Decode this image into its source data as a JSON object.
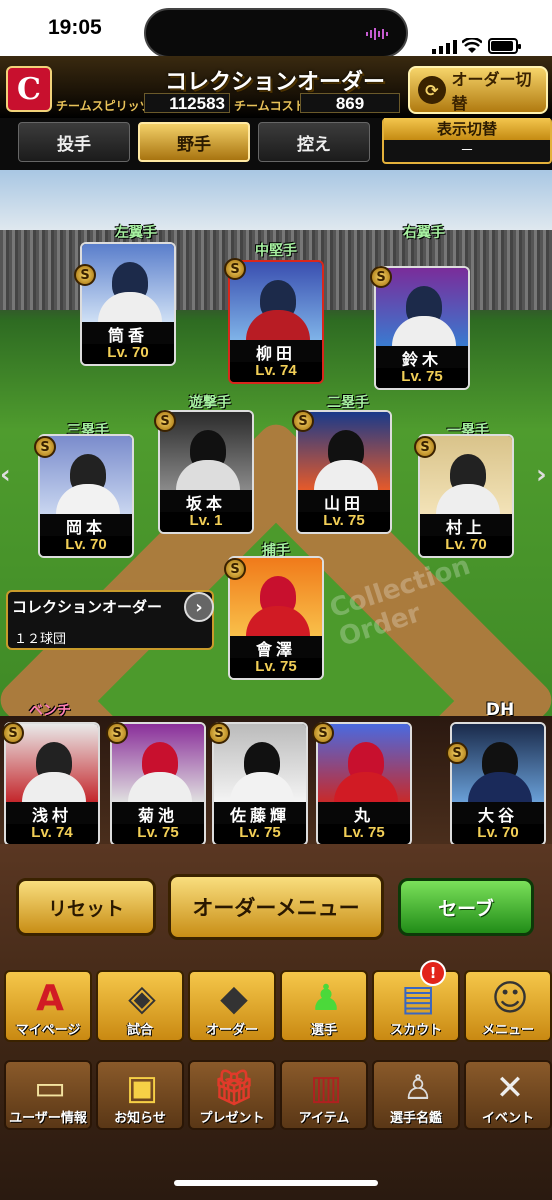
{
  "status": {
    "time": "19:05"
  },
  "header": {
    "team_logo": "C",
    "title": "コレクションオーダー",
    "spirits_label": "チームスピリッツ",
    "spirits_value": "112583",
    "cost_label": "チームコスト",
    "cost_value": "869",
    "order_switch_label": "オーダー切替"
  },
  "tabs": [
    {
      "label": "投手",
      "active": false
    },
    {
      "label": "野手",
      "active": true
    },
    {
      "label": "控え",
      "active": false
    }
  ],
  "view_toggle": {
    "label": "表示切替",
    "value": "－"
  },
  "positions": {
    "lf": "左翼手",
    "cf": "中堅手",
    "rf": "右翼手",
    "ss": "遊撃手",
    "b3": "三塁手",
    "b2": "二塁手",
    "b1": "一塁手",
    "c": "捕手",
    "bench": "ベンチ",
    "dh": "DH"
  },
  "lineup": {
    "lf": {
      "name": "筒香",
      "level": "Lv. 70"
    },
    "cf": {
      "name": "柳田",
      "level": "Lv. 74"
    },
    "rf": {
      "name": "鈴木",
      "level": "Lv. 75"
    },
    "ss": {
      "name": "坂本",
      "level": "Lv.  1"
    },
    "b3": {
      "name": "岡本",
      "level": "Lv. 70"
    },
    "b2": {
      "name": "山田",
      "level": "Lv. 75"
    },
    "b1": {
      "name": "村上",
      "level": "Lv. 70"
    },
    "c": {
      "name": "會澤",
      "level": "Lv. 75"
    }
  },
  "bench": [
    {
      "name": "浅村",
      "level": "Lv. 74"
    },
    {
      "name": "菊池",
      "level": "Lv. 75"
    },
    {
      "name": "佐藤輝",
      "level": "Lv. 75"
    },
    {
      "name": "丸",
      "level": "Lv. 75"
    }
  ],
  "dh_player": {
    "name": "大谷",
    "level": "Lv. 70"
  },
  "collection_order": {
    "title": "コレクションオーダー",
    "sub": "１２球団"
  },
  "field_watermark": "Collection Order",
  "buttons": {
    "reset": "リセット",
    "order_menu": "オーダーメニュー",
    "save": "セーブ"
  },
  "menu_row1": [
    "マイページ",
    "試合",
    "オーダー",
    "選手",
    "スカウト",
    "メニュー"
  ],
  "menu_row2": [
    "ユーザー情報",
    "お知らせ",
    "プレゼント",
    "アイテム",
    "選手名鑑",
    "イベント"
  ],
  "notification_badge": "!",
  "colors": {
    "accent_gold": "#e3b13b",
    "save_green": "#218d18",
    "team_red": "#c8102e"
  }
}
